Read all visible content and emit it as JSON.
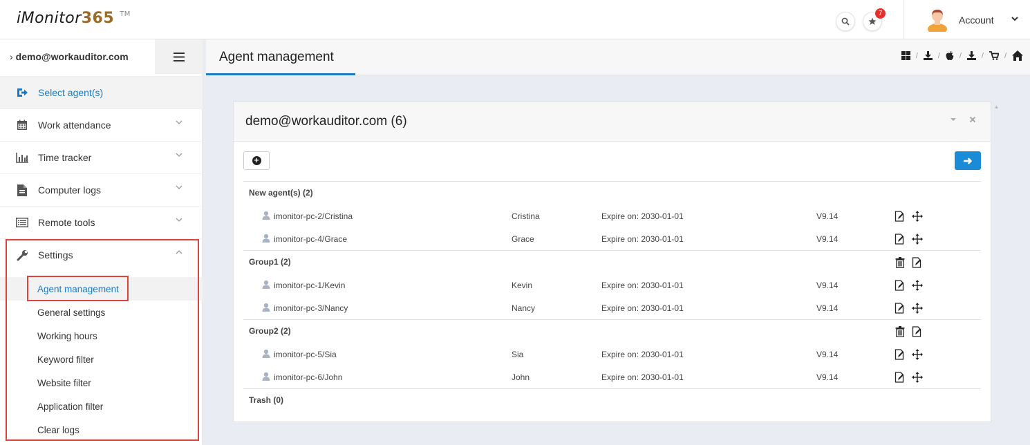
{
  "header": {
    "logo_text": "iMonitor",
    "logo_number": "365",
    "logo_tm": "TM",
    "notification_count": "7",
    "account_label": "Account"
  },
  "sidebar": {
    "user": "demo@workauditor.com",
    "items": [
      {
        "label": "Select agent(s)",
        "icon": "sign-in-icon"
      },
      {
        "label": "Work attendance",
        "icon": "calendar-icon"
      },
      {
        "label": "Time tracker",
        "icon": "bar-chart-icon"
      },
      {
        "label": "Computer logs",
        "icon": "file-icon"
      },
      {
        "label": "Remote tools",
        "icon": "list-icon"
      },
      {
        "label": "Settings",
        "icon": "wrench-icon"
      }
    ],
    "settings_sub": [
      "Agent management",
      "General settings",
      "Working hours",
      "Keyword filter",
      "Website filter",
      "Application filter",
      "Clear logs"
    ]
  },
  "page": {
    "title": "Agent management"
  },
  "panel": {
    "title": "demo@workauditor.com (6)",
    "groups": [
      {
        "label": "New agent(s) (2)",
        "agents": [
          {
            "host": "imonitor-pc-2/Cristina",
            "name": "Cristina",
            "expire": "Expire on: 2030-01-01",
            "version": "V9.14"
          },
          {
            "host": "imonitor-pc-4/Grace",
            "name": "Grace",
            "expire": "Expire on: 2030-01-01",
            "version": "V9.14"
          }
        ]
      },
      {
        "label": "Group1 (2)",
        "agents": [
          {
            "host": "imonitor-pc-1/Kevin",
            "name": "Kevin",
            "expire": "Expire on: 2030-01-01",
            "version": "V9.14"
          },
          {
            "host": "imonitor-pc-3/Nancy",
            "name": "Nancy",
            "expire": "Expire on: 2030-01-01",
            "version": "V9.14"
          }
        ]
      },
      {
        "label": "Group2 (2)",
        "agents": [
          {
            "host": "imonitor-pc-5/Sia",
            "name": "Sia",
            "expire": "Expire on: 2030-01-01",
            "version": "V9.14"
          },
          {
            "host": "imonitor-pc-6/John",
            "name": "John",
            "expire": "Expire on: 2030-01-01",
            "version": "V9.14"
          }
        ]
      },
      {
        "label": "Trash (0)",
        "agents": []
      }
    ]
  },
  "colors": {
    "accent": "#1a7bc4",
    "primary_button": "#1a8bd6",
    "highlight_border": "#d9453c",
    "badge": "#e3322d"
  }
}
